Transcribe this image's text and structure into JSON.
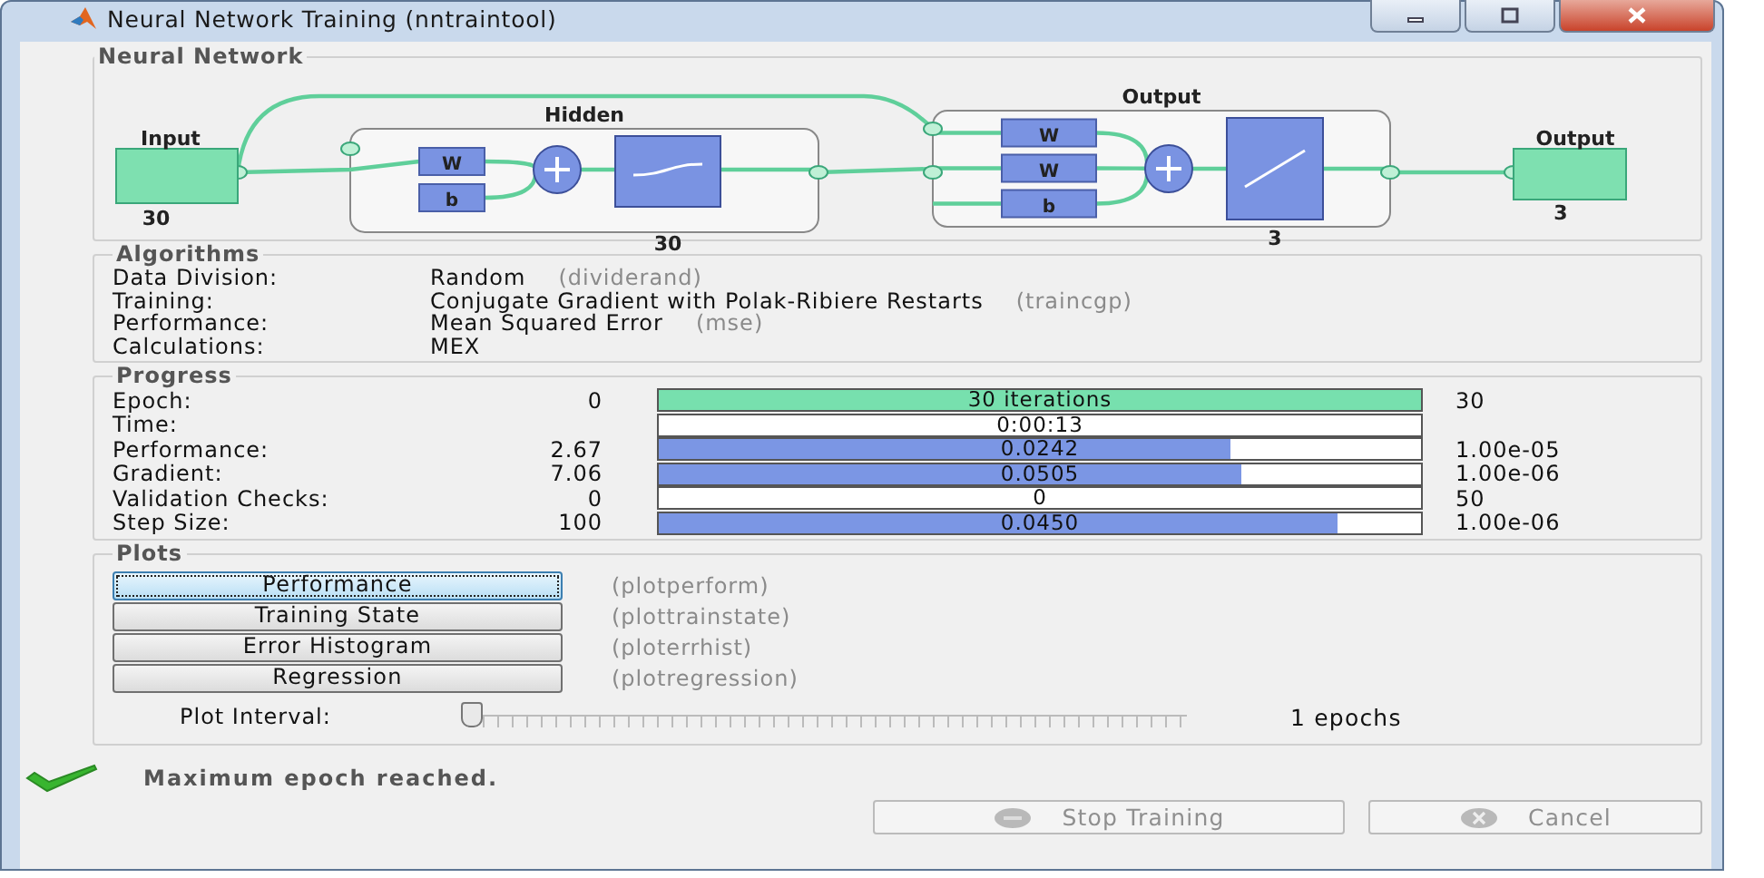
{
  "window": {
    "title": "Neural Network Training (nntraintool)"
  },
  "network": {
    "title": "Neural Network",
    "input": {
      "label": "Input",
      "size": "30"
    },
    "layers": [
      {
        "title": "Hidden",
        "weights": [
          "W"
        ],
        "bias": "b",
        "size": "30",
        "kind": "sigmoid"
      },
      {
        "title": "Output",
        "weights": [
          "W",
          "W"
        ],
        "bias": "b",
        "size": "3",
        "kind": "linear"
      }
    ],
    "output": {
      "label": "Output",
      "size": "3"
    }
  },
  "algorithms": {
    "title": "Algorithms",
    "rows": [
      {
        "label": "Data Division:",
        "value": "Random",
        "function": "(dividerand)"
      },
      {
        "label": "Training:",
        "value": "Conjugate Gradient with Polak-Ribiere Restarts",
        "function": "(traincgp)"
      },
      {
        "label": "Performance:",
        "value": "Mean Squared Error",
        "function": "(mse)"
      },
      {
        "label": "Calculations:",
        "value": "MEX"
      }
    ]
  },
  "progress": {
    "title": "Progress",
    "rows": [
      {
        "label": "Epoch:",
        "start": "0",
        "reading": "30 iterations",
        "level": 1,
        "end": "30",
        "color": "#77e0ae"
      },
      {
        "label": "Time:",
        "reading": "0:00:13"
      },
      {
        "label": "Performance:",
        "start": "2.67",
        "reading": "0.0242",
        "level": 0.75,
        "end": "1.00e-05",
        "color": "#7b96e4"
      },
      {
        "label": "Gradient:",
        "start": "7.06",
        "reading": "0.0505",
        "level": 0.765,
        "end": "1.00e-06",
        "color": "#7b96e4"
      },
      {
        "label": "Validation Checks:",
        "start": "0",
        "reading": "0",
        "end": "50"
      },
      {
        "label": "Step Size:",
        "start": "100",
        "reading": "0.0450",
        "level": 0.89,
        "end": "1.00e-06",
        "color": "#7b96e4"
      }
    ]
  },
  "plots": {
    "title": "Plots",
    "items": [
      {
        "label": "Performance",
        "function": "(plotperform)",
        "focused": true
      },
      {
        "label": "Training State",
        "function": "(plottrainstate)",
        "focused": false
      },
      {
        "label": "Error Histogram",
        "function": "(ploterrhist)",
        "focused": false
      },
      {
        "label": "Regression",
        "function": "(plotregression)",
        "focused": false
      }
    ],
    "interval": {
      "label": "Plot Interval:",
      "level": 0,
      "reading": "1 epochs"
    }
  },
  "status": {
    "message": "Maximum epoch reached."
  },
  "buttons": [
    {
      "label": "Stop Training",
      "kind": "stop",
      "disabled": true
    },
    {
      "label": "Cancel",
      "kind": "cancel",
      "disabled": true
    }
  ]
}
